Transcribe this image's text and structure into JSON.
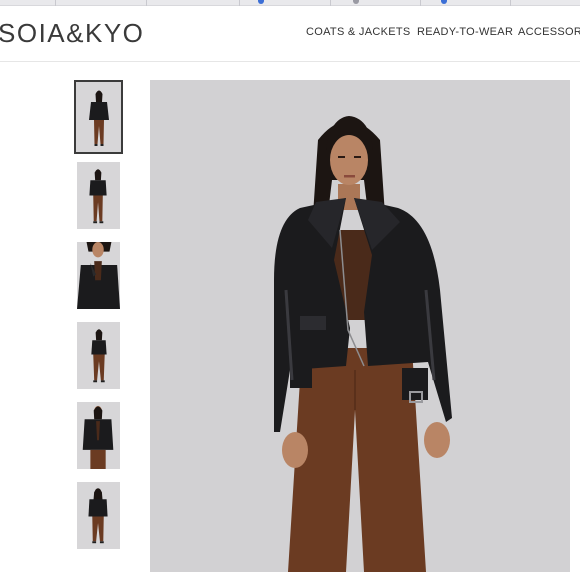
{
  "brand": {
    "logo_text": "SOIA&KYO"
  },
  "nav": {
    "items": [
      {
        "label": "COATS & JACKETS"
      },
      {
        "label": "READY-TO-WEAR"
      },
      {
        "label": "ACCESSORIES"
      }
    ]
  },
  "gallery": {
    "thumbnails": [
      {
        "view": "front-full",
        "selected": true
      },
      {
        "view": "front-full-alt",
        "selected": false
      },
      {
        "view": "close-up",
        "selected": false
      },
      {
        "view": "side-full",
        "selected": false
      },
      {
        "view": "three-quarter",
        "selected": false
      },
      {
        "view": "back-full",
        "selected": false
      }
    ],
    "main_image": {
      "subject": "model wearing black leather moto jacket and brown trousers"
    }
  },
  "colors": {
    "photo_background": "#d2d1d3",
    "jacket": "#1b1b1d",
    "trousers": "#6b3b22",
    "skin": "#b98565",
    "hair": "#1c1512"
  },
  "icons": [
    "figure-thumbnail-icon"
  ]
}
